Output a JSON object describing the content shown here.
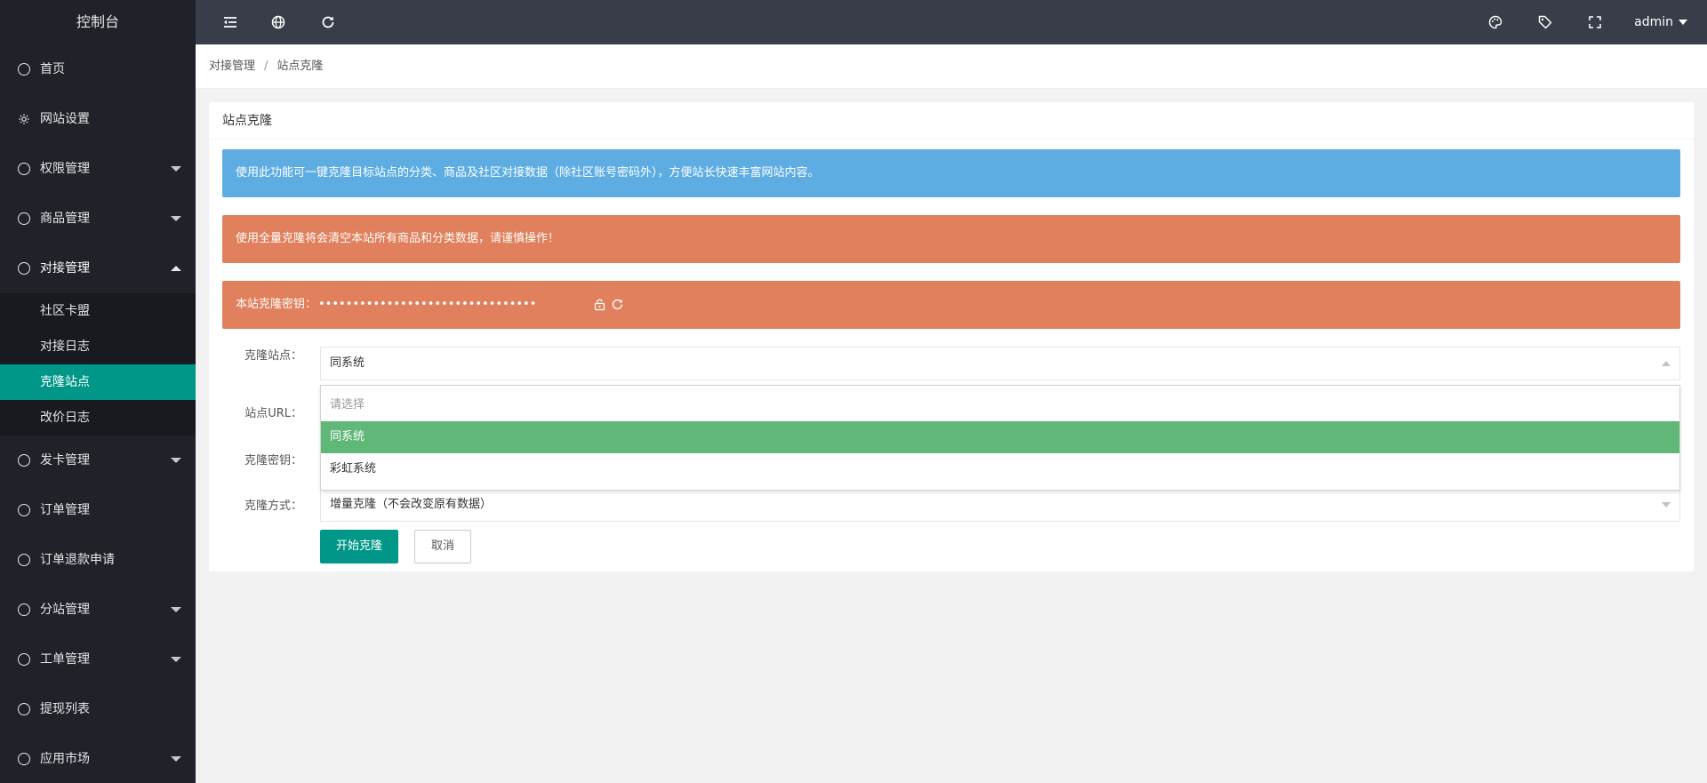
{
  "sidebar": {
    "title": "控制台",
    "items": [
      {
        "label": "首页",
        "icon": "circle-icon"
      },
      {
        "label": "网站设置",
        "icon": "gear-icon"
      },
      {
        "label": "权限管理",
        "icon": "circle-icon"
      },
      {
        "label": "商品管理",
        "icon": "circle-icon"
      },
      {
        "label": "对接管理",
        "icon": "circle-icon"
      },
      {
        "label": "发卡管理",
        "icon": "circle-icon"
      },
      {
        "label": "订单管理",
        "icon": "circle-icon"
      },
      {
        "label": "订单退款申请",
        "icon": "circle-icon"
      },
      {
        "label": "分站管理",
        "icon": "circle-icon"
      },
      {
        "label": "工单管理",
        "icon": "circle-icon"
      },
      {
        "label": "提现列表",
        "icon": "circle-icon"
      },
      {
        "label": "应用市场",
        "icon": "circle-icon"
      }
    ],
    "subitems": [
      "社区卡盟",
      "对接日志",
      "克隆站点",
      "改价日志"
    ]
  },
  "header": {
    "user": "admin",
    "icons": [
      "menu-collapse-icon",
      "globe-icon",
      "refresh-icon",
      "palette-icon",
      "tag-icon",
      "fullscreen-icon"
    ]
  },
  "breadcrumb": {
    "parent": "对接管理",
    "separator": "/",
    "current": "站点克隆"
  },
  "card": {
    "title": "站点克隆",
    "alert_info": "使用此功能可一键克隆目标站点的分类、商品及社区对接数据（除社区账号密码外），方便站长快速丰富网站内容。",
    "alert_warn": "使用全量克隆将会清空本站所有商品和分类数据，请谨慎操作！",
    "key_label": "本站克隆密钥：",
    "key_value": "••••••••••••••••••••••••••••••••"
  },
  "form": {
    "site_label": "克隆站点：",
    "site_value": "同系统",
    "url_label": "站点URL：",
    "key_label": "克隆密钥：",
    "mode_label": "克隆方式：",
    "mode_value": "增量克隆（不会改变原有数据）",
    "options": [
      "请选择",
      "同系统",
      "彩虹系统"
    ],
    "submit_label": "开始克隆",
    "cancel_label": "取消"
  },
  "colors": {
    "sidebar_bg": "#20222a",
    "header_bg": "#393d49",
    "accent": "#009688",
    "info": "#5dade2",
    "warning": "#e0805c",
    "selected_option": "#5fb878"
  }
}
